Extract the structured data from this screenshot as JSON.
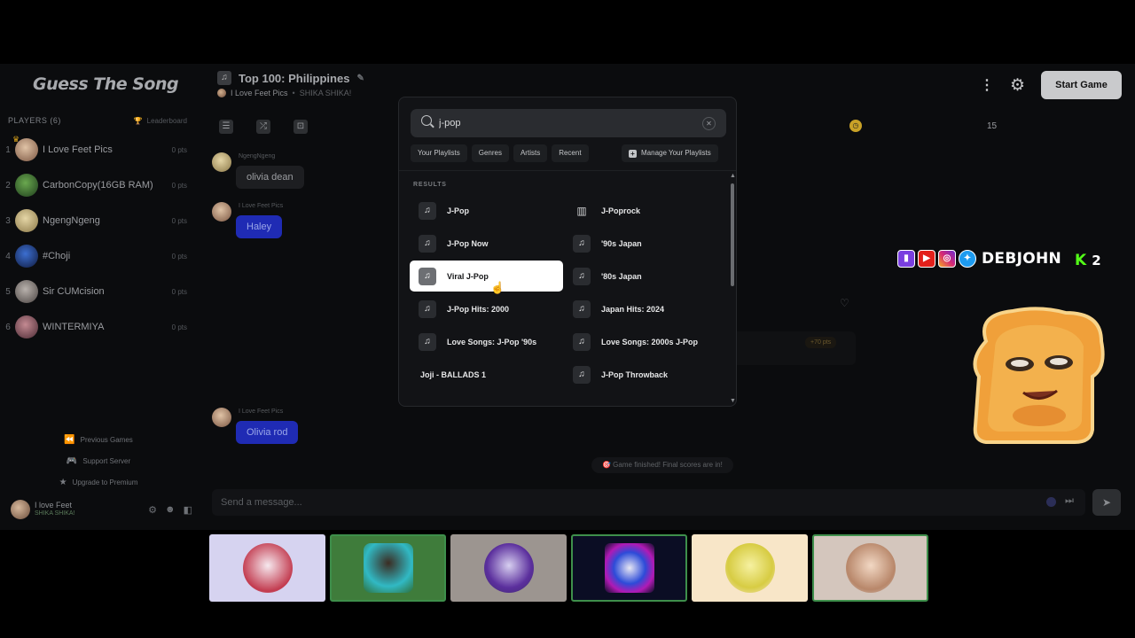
{
  "app": {
    "logo": "Guess The Song"
  },
  "players": {
    "header": "PLAYERS (6)",
    "leaderboard_label": "Leaderboard",
    "list": [
      {
        "rank": "1",
        "name": "I Love Feet Pics",
        "pts": "0 pts"
      },
      {
        "rank": "2",
        "name": "CarbonCopy(16GB RAM)",
        "pts": "0 pts"
      },
      {
        "rank": "3",
        "name": "NgengNgeng",
        "pts": "0 pts"
      },
      {
        "rank": "4",
        "name": "#Choji",
        "pts": "0 pts"
      },
      {
        "rank": "5",
        "name": "Sir CUMcision",
        "pts": "0 pts"
      },
      {
        "rank": "6",
        "name": "WINTERMIYA",
        "pts": "0 pts"
      }
    ]
  },
  "side_links": {
    "previous_games": "Previous Games",
    "support_server": "Support Server",
    "upgrade": "Upgrade to Premium"
  },
  "me": {
    "name": "I love Feet",
    "sub": "SHIKA SHIKA!"
  },
  "room": {
    "title": "Top 100: Philippines",
    "host": "I Love Feet Pics",
    "host_sub": "SHIKA SHIKA!"
  },
  "top_right": {
    "start_label": "Start Game"
  },
  "round_count": "15",
  "chat": {
    "messages": [
      {
        "user": "NgengNgeng",
        "text": "olivia dean"
      },
      {
        "user": "I Love Feet Pics",
        "text": "Haley"
      },
      {
        "user": "I Love Feet Pics",
        "text": "Olivia rod"
      }
    ],
    "game_finished": "🎯 Game finished! Final scores are in!",
    "placeholder": "Send a message...",
    "points_badge": "+70 pts"
  },
  "overlay": {
    "handle": "DEBJOHN",
    "kick_count": "2"
  },
  "modal": {
    "search_value": "j-pop",
    "filters": [
      "Your Playlists",
      "Genres",
      "Artists",
      "Recent"
    ],
    "manage_label": "Manage Your Playlists",
    "results_label": "RESULTS",
    "results": [
      {
        "label": "J-Pop",
        "icon": "playlist-icon"
      },
      {
        "label": "J-Poprock",
        "icon": "waveform-icon"
      },
      {
        "label": "J-Pop Now",
        "icon": "playlist-icon"
      },
      {
        "label": "'90s Japan",
        "icon": "playlist-icon"
      },
      {
        "label": "Viral J-Pop",
        "icon": "playlist-icon",
        "selected": true
      },
      {
        "label": "'80s Japan",
        "icon": "playlist-icon"
      },
      {
        "label": "J-Pop Hits: 2000",
        "icon": "playlist-icon"
      },
      {
        "label": "Japan Hits: 2024",
        "icon": "playlist-icon"
      },
      {
        "label": "Love Songs: J-Pop '90s",
        "icon": "playlist-icon"
      },
      {
        "label": "Love Songs: 2000s J-Pop",
        "icon": "playlist-icon"
      },
      {
        "label": "Joji - BALLADS 1",
        "icon": "album-icon"
      },
      {
        "label": "J-Pop Throwback",
        "icon": "playlist-icon"
      }
    ]
  },
  "colors": {
    "selected_result_bg": "#ffffff",
    "chat_bubble_blue": "#1f2bb4",
    "start_button": "#c9cacc"
  }
}
